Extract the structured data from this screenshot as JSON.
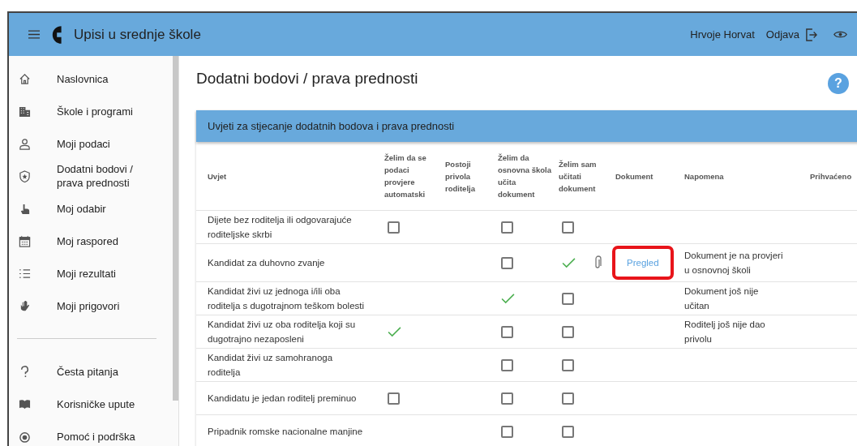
{
  "header": {
    "app_title": "Upisi u srednje škole",
    "user_name": "Hrvoje Horvat",
    "logout": "Odjava"
  },
  "sidebar": {
    "items": [
      {
        "label": "Naslovnica"
      },
      {
        "label": "Škole i programi"
      },
      {
        "label": "Moji podaci"
      },
      {
        "label": "Dodatni bodovi / prava prednosti"
      },
      {
        "label": "Moj odabir"
      },
      {
        "label": "Moj raspored"
      },
      {
        "label": "Moji rezultati"
      },
      {
        "label": "Moji prigovori"
      }
    ],
    "secondary_items": [
      {
        "label": "Česta pitanja"
      },
      {
        "label": "Korisničke upute"
      },
      {
        "label": "Pomoć i podrška"
      }
    ]
  },
  "page": {
    "title": "Dodatni bodovi / prava prednosti",
    "help": "?"
  },
  "card": {
    "title": "Uvjeti za stjecanje dodatnih bodova i prava prednosti",
    "table": {
      "columns": [
        "Uvjet",
        "Želim da se podaci provjere automatski",
        "Postoji privola roditelja",
        "Želim da osnovna škola učita dokument",
        "Želim sam učitati dokument",
        "Dokument",
        "Napomena",
        "Prihvaćeno"
      ],
      "rows": [
        {
          "condition": "Dijete bez roditelja ili odgovarajuće roditeljske skrbi",
          "auto": {
            "kind": "checkbox"
          },
          "school": {
            "kind": "checkbox"
          },
          "self": {
            "kind": "checkbox"
          },
          "document": null,
          "note": null
        },
        {
          "condition": "Kandidat za duhovno zvanje",
          "auto": {
            "kind": "none"
          },
          "school": {
            "kind": "checkbox"
          },
          "self": {
            "kind": "tick",
            "attachment": true
          },
          "document": {
            "text": "Pregled",
            "highlighted": true
          },
          "note": "Dokument je na provjeri u osnovnoj školi"
        },
        {
          "condition": "Kandidat živi uz jednoga i/ili oba roditelja s dugotrajnom teškom bolesti",
          "auto": {
            "kind": "none"
          },
          "school": {
            "kind": "tick"
          },
          "self": {
            "kind": "checkbox"
          },
          "document": null,
          "note": "Dokument još nije učitan"
        },
        {
          "condition": "Kandidat živi uz oba roditelja koji su dugotrajno nezaposleni",
          "auto": {
            "kind": "tick"
          },
          "school": {
            "kind": "checkbox"
          },
          "self": {
            "kind": "checkbox"
          },
          "document": null,
          "note": "Roditelj još nije dao privolu"
        },
        {
          "condition": "Kandidat živi uz samohranoga roditelja",
          "auto": {
            "kind": "none"
          },
          "school": {
            "kind": "checkbox"
          },
          "self": {
            "kind": "checkbox"
          },
          "document": null,
          "note": null
        },
        {
          "condition": "Kandidatu je jedan roditelj preminuo",
          "auto": {
            "kind": "checkbox"
          },
          "school": {
            "kind": "checkbox"
          },
          "self": {
            "kind": "checkbox"
          },
          "document": null,
          "note": null
        },
        {
          "condition": "Pripadnik romske nacionalne manjine",
          "auto": {
            "kind": "none"
          },
          "school": {
            "kind": "checkbox"
          },
          "self": {
            "kind": "checkbox"
          },
          "document": null,
          "note": null
        }
      ]
    }
  }
}
